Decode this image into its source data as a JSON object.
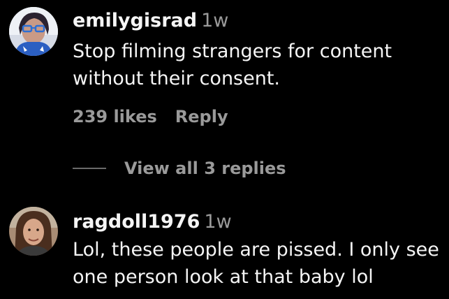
{
  "comments": [
    {
      "username": "emilygisrad",
      "time": "1w",
      "text_line1": "Stop filming strangers for content",
      "text_line2": "without their consent.",
      "likes": "239 likes",
      "reply_label": "Reply",
      "view_replies": "View all 3 replies"
    },
    {
      "username": "ragdoll1976",
      "time": "1w",
      "text_line1": "Lol, these people are pissed. I only see",
      "text_line2": "one person look at that baby lol"
    }
  ]
}
